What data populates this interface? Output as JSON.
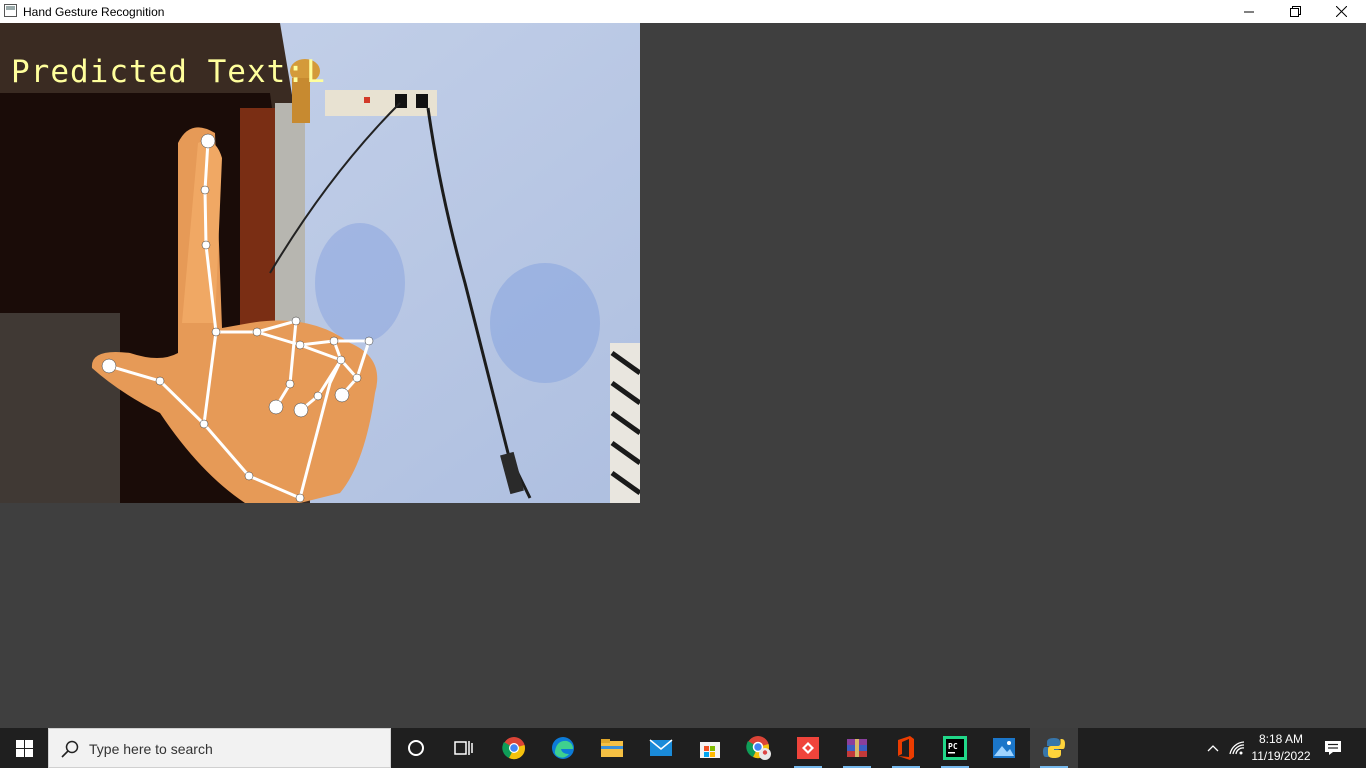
{
  "window": {
    "title": "Hand Gesture Recognition"
  },
  "overlay": {
    "predicted_text": "Predicted Text:L"
  },
  "taskbar": {
    "search_placeholder": "Type here to search",
    "time": "8:18 AM",
    "date": "11/19/2022",
    "pinned": [
      "cortana-icon",
      "task-view-icon",
      "chrome-icon",
      "edge-icon",
      "file-explorer-icon",
      "mail-icon",
      "store-icon",
      "chrome-profile-icon",
      "anydesk-icon",
      "winrar-icon",
      "office-icon",
      "pycharm-icon",
      "photos-icon",
      "python-icon"
    ]
  },
  "colors": {
    "background": "#3f3f3f",
    "taskbar": "#1f1f1f",
    "overlay_text": "#ffff9c",
    "landmarks": "#ffffff"
  }
}
